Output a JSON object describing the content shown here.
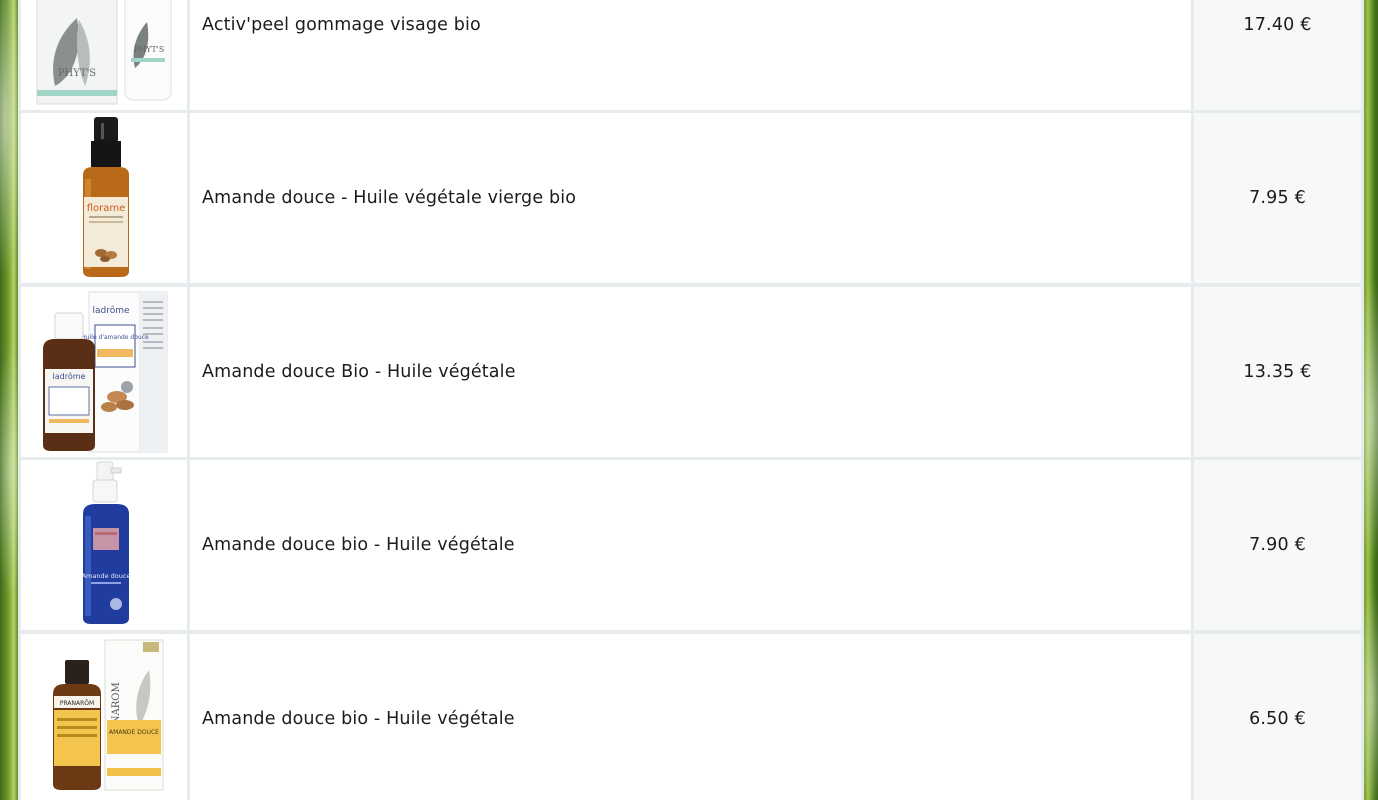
{
  "products": [
    {
      "name": "Activ'peel gommage visage bio",
      "price": "17.40 €",
      "image_icon": "phyts-cream-tube-icon",
      "brand_marks": [
        "PHYT'S",
        "PHYT'S"
      ]
    },
    {
      "name": "Amande douce - Huile végétale vierge bio",
      "price": "7.95 €",
      "image_icon": "florame-oil-bottle-icon",
      "brand_marks": [
        "florame"
      ]
    },
    {
      "name": "Amande douce Bio - Huile végétale",
      "price": "13.35 €",
      "image_icon": "ladrome-oil-box-icon",
      "brand_marks": [
        "ladrôme",
        "Huile d'amande douce",
        "ladrôme"
      ]
    },
    {
      "name": "Amande douce bio - Huile végétale",
      "price": "7.90 €",
      "image_icon": "blue-spray-bottle-icon",
      "brand_marks": [
        "Amande douce"
      ]
    },
    {
      "name": "Amande douce bio - Huile végétale",
      "price": "6.50 €",
      "image_icon": "pranarom-oil-box-icon",
      "brand_marks": [
        "PRANAROM",
        "PRANARÔM",
        "AMANDE DOUCE"
      ]
    }
  ],
  "colors": {
    "table_grid": "#e6eced",
    "cell_background": "#ffffff",
    "price_background": "#f7f8f8",
    "text": "#1c1c1c",
    "page_foliage": "#5c8a22"
  }
}
